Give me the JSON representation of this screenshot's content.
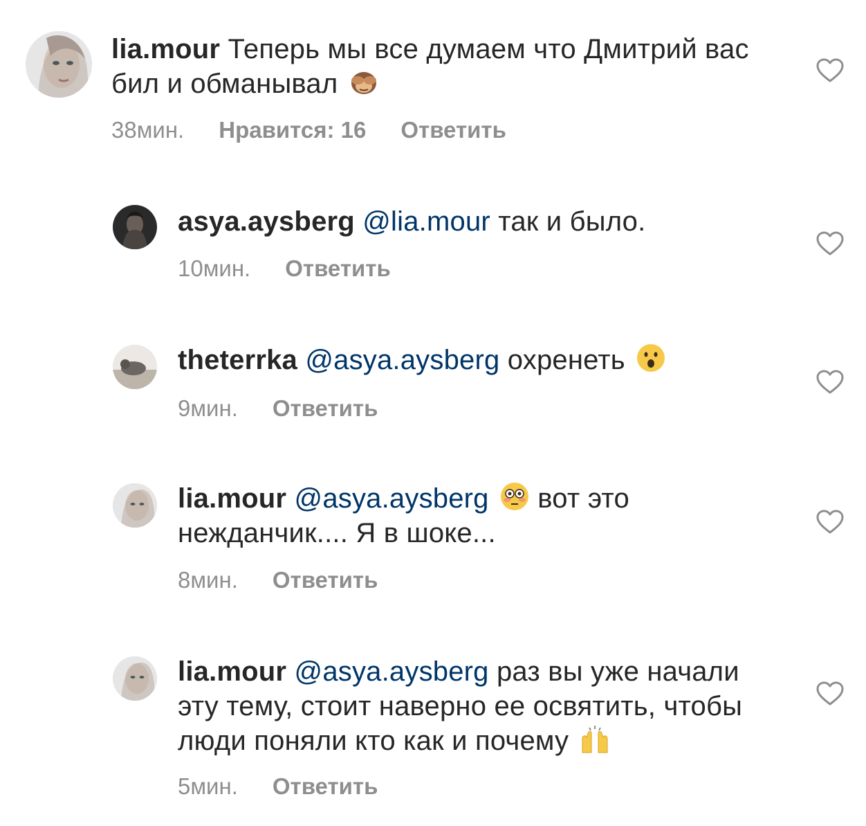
{
  "comments": [
    {
      "username": "lia.mour",
      "mention": "",
      "text_before_emoji": "Теперь мы все думаем что Дмитрий вас бил и обманывал",
      "text_after_emoji": "",
      "emoji": "see-no-evil-monkey",
      "time": "38мин.",
      "likes": "Нравится: 16",
      "reply": "Ответить"
    },
    {
      "username": "asya.aysberg",
      "mention": "@lia.mour",
      "text_before_emoji": "так и было.",
      "text_after_emoji": "",
      "emoji": "",
      "time": "10мин.",
      "reply": "Ответить"
    },
    {
      "username": "theterrka",
      "mention": "@asya.aysberg",
      "text_before_emoji": "охренеть",
      "text_after_emoji": "",
      "emoji": "surprised-face",
      "time": "9мин.",
      "reply": "Ответить"
    },
    {
      "username": "lia.mour",
      "mention": "@asya.aysberg",
      "text_before_emoji": "",
      "text_after_emoji": "вот это нежданчик.... Я в шоке...",
      "emoji": "flushed-face",
      "time": "8мин.",
      "reply": "Ответить"
    },
    {
      "username": "lia.mour",
      "mention": "@asya.aysberg",
      "text_before_emoji": "раз вы уже начали эту тему, стоит наверно ее освятить, чтобы люди поняли кто как и почему",
      "text_after_emoji": "",
      "emoji": "raising-hands",
      "time": "5мин.",
      "reply": "Ответить"
    }
  ],
  "colors": {
    "text": "#262626",
    "mention": "#003569",
    "meta": "#8e8e8e",
    "heart_stroke": "#8e8e8e"
  }
}
